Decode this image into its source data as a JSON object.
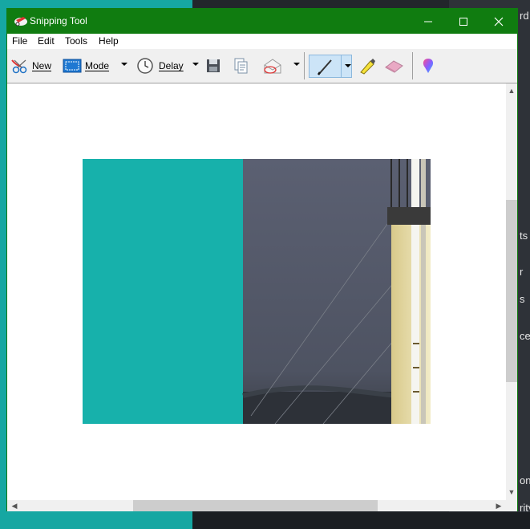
{
  "window": {
    "title": "Snipping Tool"
  },
  "menu": [
    "File",
    "Edit",
    "Tools",
    "Help"
  ],
  "toolbar": {
    "new_label": "New",
    "mode_label": "Mode",
    "delay_label": "Delay"
  },
  "desktop_fragments": [
    "rd",
    "ts",
    "r",
    "s",
    "ce",
    "on",
    "rity"
  ],
  "colors": {
    "titlebar": "#107c10",
    "desktop": "#16a7a2",
    "snip_teal": "#17b1ab"
  }
}
